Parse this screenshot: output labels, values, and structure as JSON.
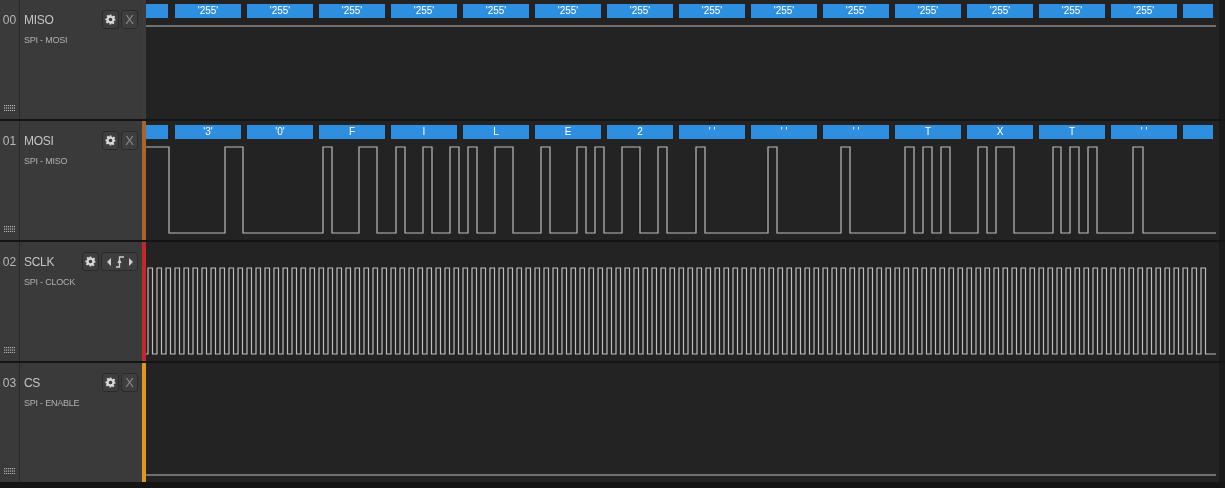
{
  "channels": [
    {
      "index": "00",
      "name": "MISO",
      "subtitle": "SPI - MOSI",
      "color": "#3c3c3c",
      "action": {
        "kind": "close",
        "label": "X"
      },
      "kind": "high",
      "decoded": [
        "'255'",
        "'255'",
        "'255'",
        "'255'",
        "'255'",
        "'255'",
        "'255'",
        "'255'",
        "'255'",
        "'255'",
        "'255'",
        "'255'",
        "'255'",
        "'255'"
      ]
    },
    {
      "index": "01",
      "name": "MOSI",
      "subtitle": "SPI - MISO",
      "color": "#a8642c",
      "action": {
        "kind": "close",
        "label": "X"
      },
      "kind": "data",
      "decoded": [
        "'3'",
        "'0'",
        "F",
        "I",
        "L",
        "E",
        "2",
        "' '",
        "' '",
        "' '",
        "T",
        "X",
        "T",
        "' '"
      ]
    },
    {
      "index": "02",
      "name": "SCLK",
      "subtitle": "SPI - CLOCK",
      "color": "#c4262e",
      "action": {
        "kind": "trigger"
      },
      "kind": "clock"
    },
    {
      "index": "03",
      "name": "CS",
      "subtitle": "SPI - ENABLE",
      "color": "#dc9a1c",
      "action": {
        "kind": "close",
        "label": "X"
      },
      "kind": "low"
    }
  ]
}
